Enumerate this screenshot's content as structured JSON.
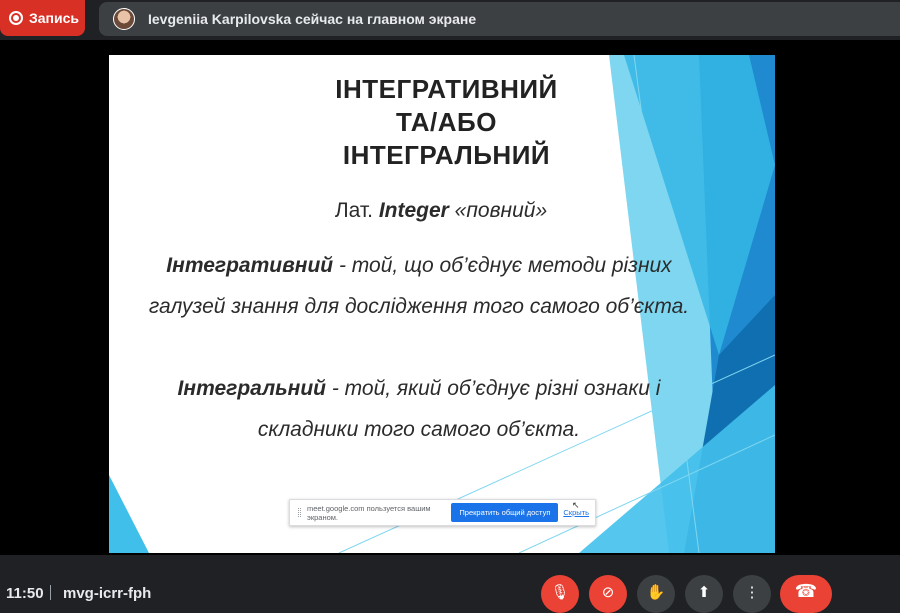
{
  "top_bar": {
    "record_label": "Запись",
    "presenter_text": "Ievgeniia Karpilovska сейчас на главном экране"
  },
  "slide": {
    "title_lines": [
      "ІНТЕГРАТИВНИЙ",
      "ТА/АБО",
      "ІНТЕГРАЛЬНИЙ"
    ],
    "latin_prefix": "Лат. ",
    "latin_word": "Integer",
    "latin_translation": " «повний»",
    "def1_term": "Інтегративний",
    "def1_text": " - той, що об’єднує методи різних галузей знання для дослідження того самого об’єкта.",
    "def2_term": "Інтегральний",
    "def2_text": " - той, який об’єднує різні ознаки і складники того самого об’єкта."
  },
  "share_notice": {
    "text": "meet.google.com пользуется вашим экраном.",
    "stop_label": "Прекратить общий доступ",
    "hide_label": "Скрыть"
  },
  "bottom_bar": {
    "time": "11:50",
    "meeting_code": "mvg-icrr-fph"
  },
  "controls": [
    {
      "name": "microphone-off-button",
      "icon": "mic-off-icon",
      "glyph": "🎙"
    },
    {
      "name": "camera-off-button",
      "icon": "camera-off-icon",
      "glyph": "⊘"
    },
    {
      "name": "raise-hand-button",
      "icon": "hand-icon",
      "glyph": "✋"
    },
    {
      "name": "present-button",
      "icon": "present-icon",
      "glyph": "⬆"
    },
    {
      "name": "more-options-button",
      "icon": "more-vert-icon",
      "glyph": "⋮"
    }
  ],
  "colors": {
    "record_red": "#d93025",
    "accent_blue": "#1a73e8",
    "slide_cyan": "#4fc3e8",
    "slide_deep_blue": "#1565a8"
  }
}
